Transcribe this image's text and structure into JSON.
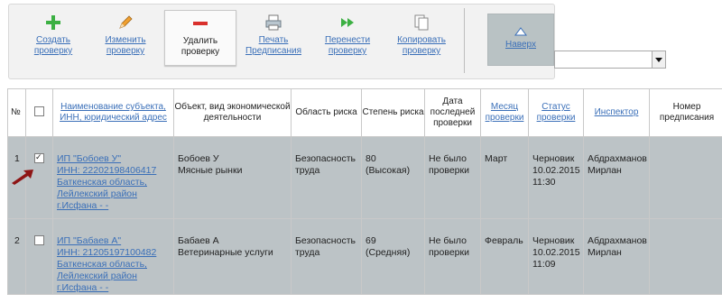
{
  "toolbar": {
    "create": {
      "label": "Создать проверку",
      "icon": "plus-icon",
      "color": "#3cb043"
    },
    "edit": {
      "label": "Изменить проверку",
      "icon": "pencil-icon"
    },
    "delete": {
      "label": "Удалить проверку",
      "icon": "minus-icon",
      "color": "#d9302c"
    },
    "print": {
      "label": "Печать Предписания",
      "icon": "printer-icon"
    },
    "move": {
      "label": "Перенести проверку",
      "icon": "fast-forward-icon",
      "color": "#3cb043"
    },
    "copy": {
      "label": "Копировать проверку",
      "icon": "copy-icon"
    },
    "up": {
      "label": "Наверх",
      "icon": "triangle-up-icon"
    }
  },
  "filter": {
    "value": ""
  },
  "table": {
    "headers": {
      "num": "№",
      "subject": "Наименование субъекта, ИНН, юридический адрес",
      "object": "Объект, вид экономической деятельности",
      "area": "Область риска",
      "degree": "Степень риска",
      "last_check": "Дата последней проверки",
      "month": "Месяц проверки",
      "status": "Статус проверки",
      "inspector": "Инспектор",
      "order": "Номер предписания"
    },
    "rows": [
      {
        "num": "1",
        "checked": true,
        "subject_name": "ИП \"Бобоев У\"",
        "subject_inn": "ИНН: 22202198406417",
        "subject_addr1": "Баткенская область,",
        "subject_addr2": "Лейлекский район",
        "subject_addr3": "г.Исфана - -",
        "object1": "Бобоев У",
        "object2": "Мясные рынки",
        "area": "Безопасность труда",
        "degree1": "80",
        "degree2": "(Высокая)",
        "last_check": "Не было проверки",
        "month": "Март",
        "status1": "Черновик",
        "status2": "10.02.2015",
        "status3": "11:30",
        "inspector": "Абдрахманов Мирлан",
        "order": ""
      },
      {
        "num": "2",
        "checked": false,
        "subject_name": "ИП \"Бабаев А\"",
        "subject_inn": "ИНН: 21205197100482",
        "subject_addr1": "Баткенская область,",
        "subject_addr2": "Лейлекский район",
        "subject_addr3": "г.Исфана - -",
        "object1": "Бабаев А",
        "object2": "Ветеринарные услуги",
        "area": "Безопасность труда",
        "degree1": "69",
        "degree2": "(Средняя)",
        "last_check": "Не было проверки",
        "month": "Февраль",
        "status1": "Черновик",
        "status2": "10.02.2015",
        "status3": "11:09",
        "inspector": "Абдрахманов Мирлан",
        "order": ""
      }
    ]
  }
}
